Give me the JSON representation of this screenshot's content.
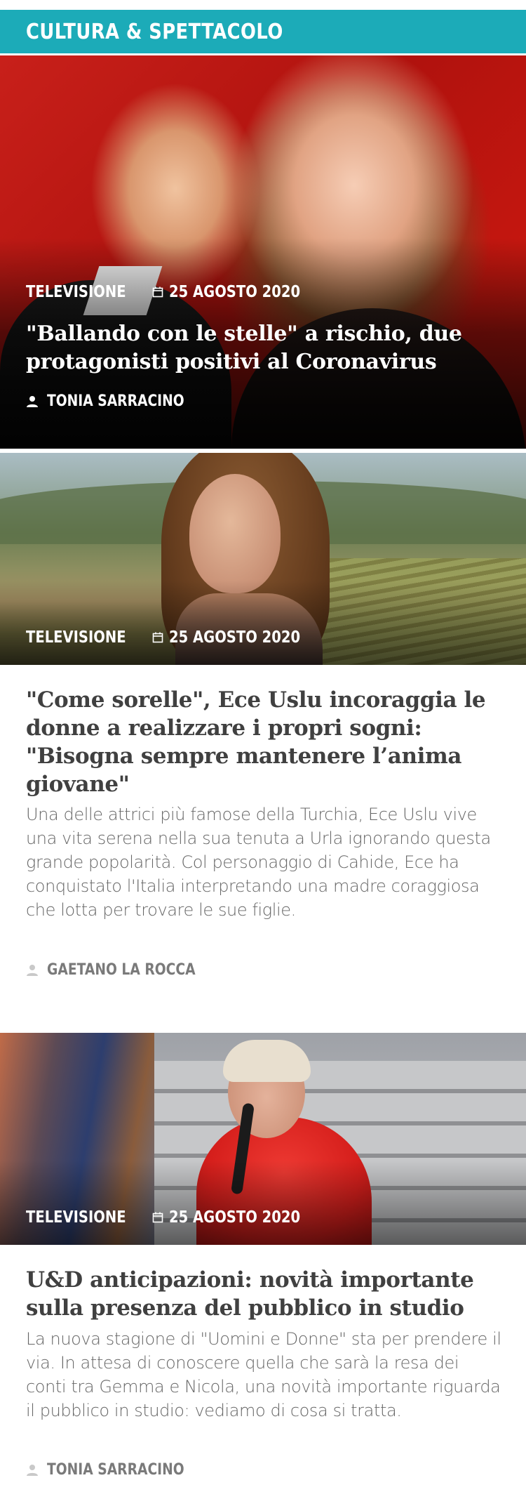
{
  "section": {
    "title": "CULTURA & SPETTACOLO"
  },
  "articles": [
    {
      "category": "TELEVISIONE",
      "date": "25 AGOSTO 2020",
      "title": "\"Ballando con le stelle\" a rischio, due protagonisti positivi al Coronavirus",
      "author": "TONIA SARRACINO"
    },
    {
      "category": "TELEVISIONE",
      "date": "25 AGOSTO 2020",
      "title": "\"Come sorelle\", Ece Uslu incoraggia le donne a realizzare i propri sogni: \"Bisogna sempre mantenere l’anima giovane\"",
      "excerpt": "Una delle attrici più famose della Turchia, Ece Uslu vive una vita serena nella sua tenuta a Urla ignorando questa grande popolarità. Col personaggio di Cahide, Ece ha conquistato l'Italia interpretando una madre coraggiosa che lotta per trovare le sue figlie.",
      "author": "GAETANO LA ROCCA"
    },
    {
      "category": "TELEVISIONE",
      "date": "25 AGOSTO 2020",
      "title": "U&D anticipazioni: novità importante sulla presenza del pubblico in studio",
      "excerpt": "La nuova stagione di \"Uomini e Donne\" sta per prendere il via. In attesa di conoscere quella che sarà la resa dei conti tra Gemma e Nicola, una novità importante riguarda il pubblico in studio: vediamo di cosa si tratta.",
      "author": "TONIA SARRACINO"
    }
  ],
  "colors": {
    "section_bar": "#1cabb8",
    "title_dark": "#404040",
    "excerpt": "#666666",
    "author_dark": "#7a7a7a"
  },
  "icons": {
    "date": "calendar-icon",
    "author": "user-icon"
  }
}
